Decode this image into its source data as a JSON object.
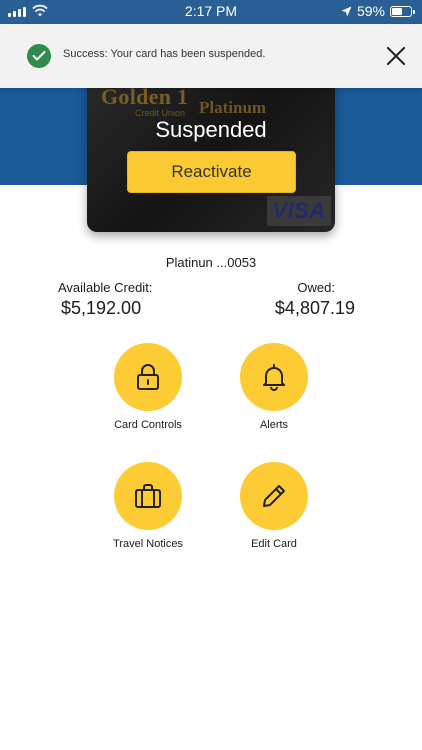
{
  "status_bar": {
    "time": "2:17 PM",
    "battery": "59%",
    "battery_level": 0.59
  },
  "banner": {
    "message": "Success: Your card has been suspended."
  },
  "card": {
    "brand": "Golden 1",
    "brand_sub": "Credit Union",
    "tier": "Platinum",
    "network": "VISA",
    "status": "Suspended",
    "reactivate_label": "Reactivate"
  },
  "account": {
    "card_name": "Platinun ...0053",
    "available_label": "Available Credit:",
    "available_value": "$5,192.00",
    "owed_label": "Owed:",
    "owed_value": "$4,807.19"
  },
  "actions": [
    {
      "label": "Card Controls",
      "icon": "lock-icon"
    },
    {
      "label": "Alerts",
      "icon": "bell-icon"
    },
    {
      "label": "Travel Notices",
      "icon": "suitcase-icon"
    },
    {
      "label": "Edit Card",
      "icon": "pencil-icon"
    }
  ],
  "colors": {
    "accent": "#fdcc35",
    "band": "#1a5a99",
    "success": "#2e8b4a"
  }
}
